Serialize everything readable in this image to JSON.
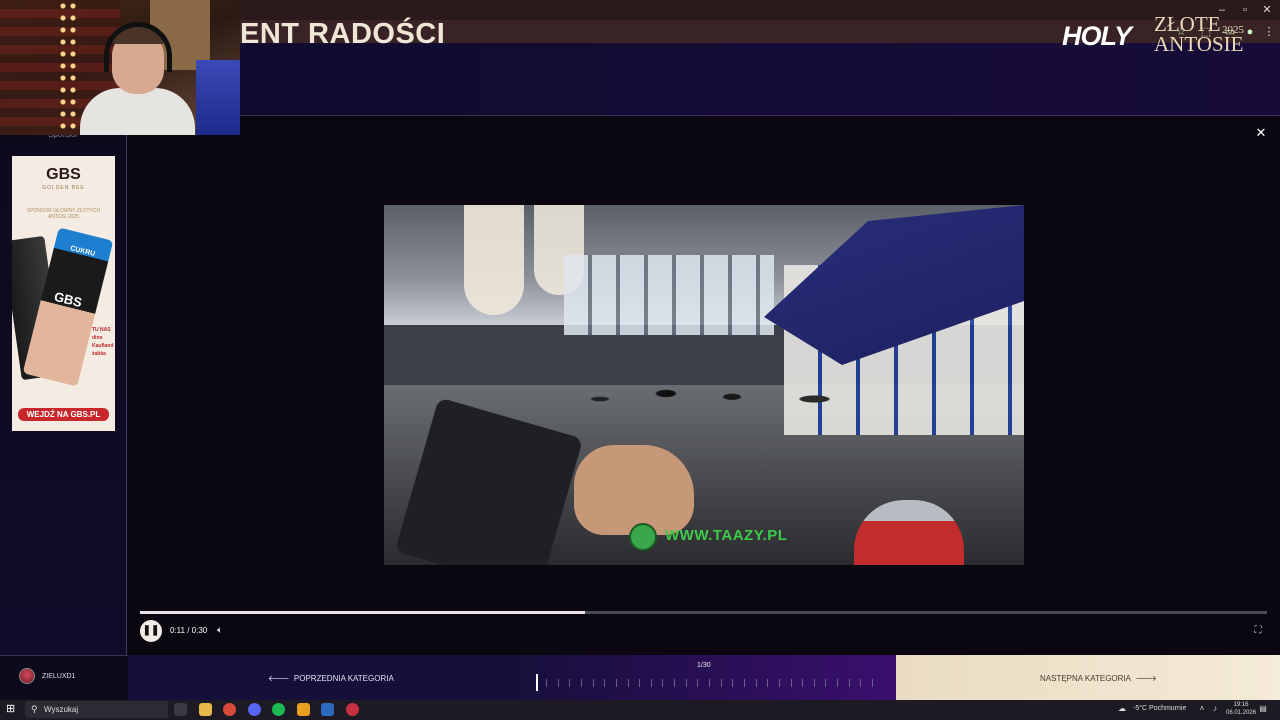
{
  "header": {
    "title": "ENT RADOŚCI",
    "brand_holy": "HOLY",
    "brand_line1": "ZŁOTE",
    "brand_line2": "ANTOSIE",
    "brand_year": "2025"
  },
  "left_panel": {
    "sponsor_label": "Sponsor",
    "ad": {
      "logo": "GBS",
      "logo_sub": "GOLDEN BEE",
      "sponsor_text": "SPONSOR GŁÓWNY ZŁOTYCH ANTOSI 2025",
      "can_label": "CUKRU",
      "can_brand": "GBS",
      "stores": [
        "TU NAS",
        "dino",
        "Kaufland",
        "żabka"
      ],
      "cta": "WEJDŹ NA GBS.PL"
    }
  },
  "video": {
    "watermark": "WWW.TAAZY.PL",
    "progress": 0.395
  },
  "player": {
    "time": "0:11 / 0:30",
    "pause_icon": "pause-icon",
    "volume_icon": "volume-icon",
    "fullscreen_icon": "fullscreen-icon"
  },
  "bottom_bar": {
    "user_name": "ZIELUXD1",
    "prev_label": "POPRZEDNIA KATEGORIA",
    "counter": "1/30",
    "counter_value": 1,
    "counter_total": 30,
    "next_label": "NASTĘPNA KATEGORIA"
  },
  "taskbar": {
    "search_placeholder": "Wyszukaj",
    "weather": "-5°C  Pochmurnie",
    "time": "19:16",
    "date": "06.01.2026"
  },
  "colors": {
    "next_accent": "#f4ebd8",
    "header_bg": "#140c36",
    "ad_cta": "#c8282c",
    "watermark": "#3ecb4a"
  }
}
